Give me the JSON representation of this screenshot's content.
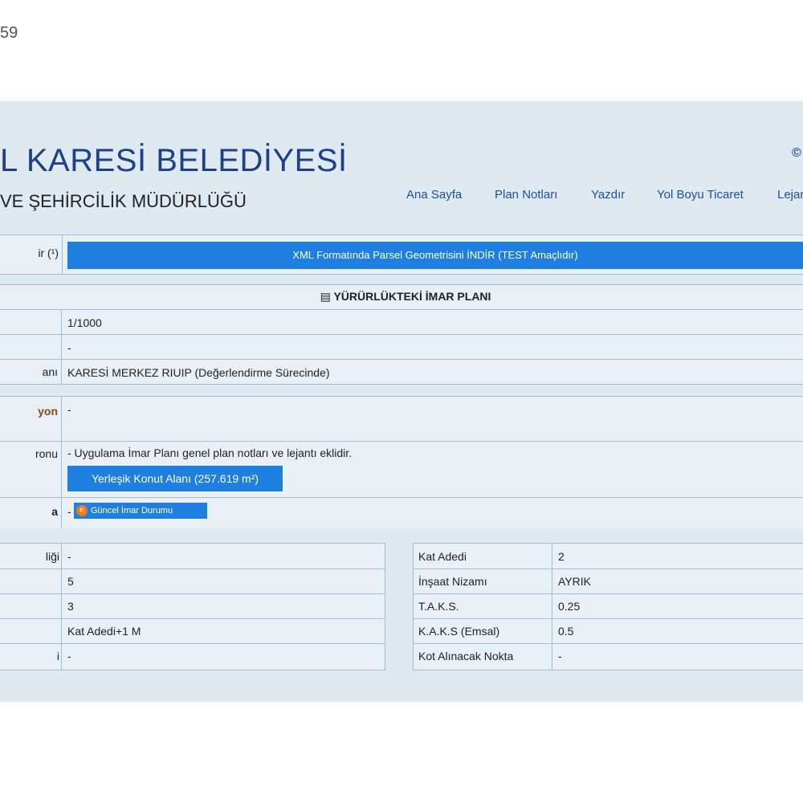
{
  "corner_label": "59",
  "header": {
    "title": "L KARESİ BELEDİYESİ",
    "subtitle": "VE ŞEHİRCİLİK MÜDÜRLÜĞÜ",
    "corner_icon": "©"
  },
  "nav": {
    "items": [
      "Ana Sayfa",
      "Plan Notları",
      "Yazdır",
      "Yol Boyu Ticaret",
      "Lejan"
    ]
  },
  "download": {
    "label": "ir (¹)",
    "button": "XML Formatında Parsel Geometrisini İNDİR (TEST Amaçlıdır)"
  },
  "plan": {
    "section_title": "YÜRÜRLÜKTEKİ İMAR PLANI",
    "rows": [
      {
        "label": "",
        "value": "1/1000"
      },
      {
        "label": "",
        "value": "-"
      },
      {
        "label": "anı",
        "value": "KARESİ MERKEZ RIUIP (Değerlendirme Sürecinde)"
      }
    ],
    "function_label": "yon",
    "function_value": "-",
    "zone_label": "ronu",
    "zone_note": "- Uygulama İmar Planı genel plan notları ve lejantı eklidir.",
    "zone_button": "Yerleşik Konut Alanı (257.619 m²)",
    "status_label": "a",
    "status_prefix": "-",
    "status_button": "Güncel İmar Durumu"
  },
  "left_table": [
    {
      "label": "liği",
      "value": "-"
    },
    {
      "label": "",
      "value": "5"
    },
    {
      "label": "",
      "value": "3"
    },
    {
      "label": "",
      "value": "Kat Adedi+1 M"
    },
    {
      "label": "i",
      "value": "-"
    }
  ],
  "right_table": [
    {
      "label": "Kat Adedi",
      "value": "2"
    },
    {
      "label": "İnşaat Nizamı",
      "value": "AYRIK"
    },
    {
      "label": "T.A.K.S.",
      "value": "0.25"
    },
    {
      "label": "K.A.K.S (Emsal)",
      "value": "0.5"
    },
    {
      "label": "Kot Alınacak Nokta",
      "value": "-"
    }
  ],
  "colors": {
    "accent": "#1f7fe0",
    "title": "#1e3f8a",
    "panel": "#dfe9f1",
    "status_icon": "#f07a1a"
  }
}
